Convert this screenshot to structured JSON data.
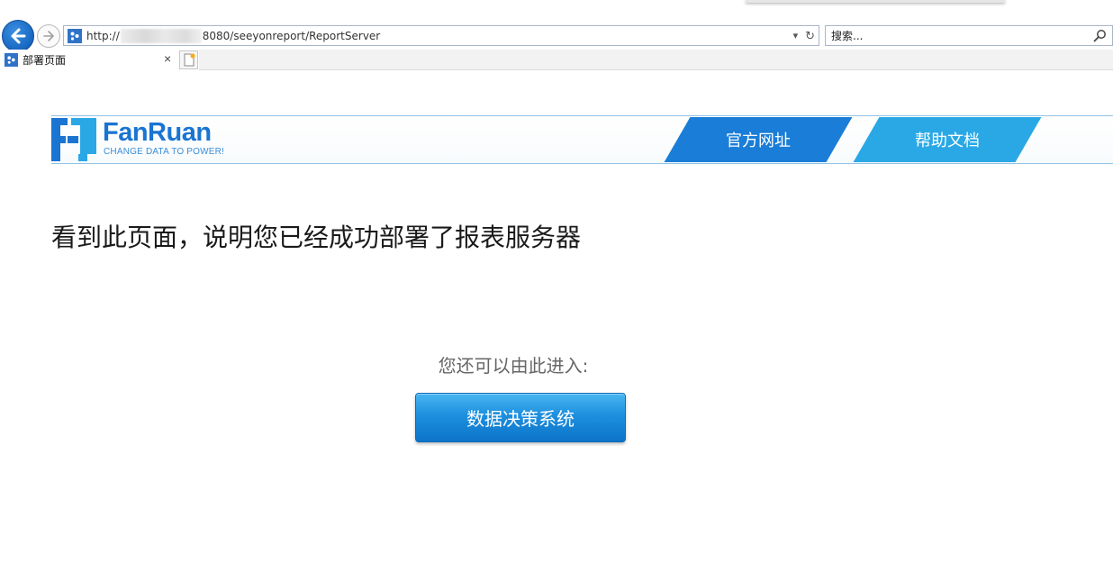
{
  "browser": {
    "url_prefix": "http://",
    "url_suffix": "8080/seeyonreport/ReportServer",
    "search_placeholder": "搜索...",
    "tab_title": "部署页面",
    "tab_close": "×",
    "dropdown_glyph": "▾",
    "refresh_glyph": "↻"
  },
  "page": {
    "logo_word": "FanRuan",
    "logo_tagline": "CHANGE DATA TO POWER!",
    "nav": {
      "official_site": "官方网址",
      "help_docs": "帮助文档"
    },
    "headline": "看到此页面，说明您已经成功部署了报表服务器",
    "enter_hint": "您还可以由此进入:",
    "enter_button": "数据决策系统"
  },
  "colors": {
    "accent_dark": "#1a7dd7",
    "accent_light": "#2aa8e6",
    "logo_blue": "#1a74d2"
  }
}
